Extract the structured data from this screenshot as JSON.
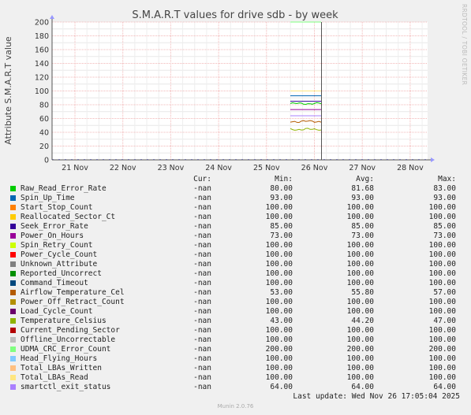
{
  "chart_data": {
    "type": "line",
    "title": "S.M.A.R.T values for drive sdb - by week",
    "ylabel": "Attribute S.M.A.R.T value",
    "ylim": [
      0,
      200
    ],
    "yticks": [
      "0",
      "20",
      "40",
      "60",
      "80",
      "100",
      "120",
      "140",
      "160",
      "180",
      "200"
    ],
    "categories": [
      "21 Nov",
      "22 Nov",
      "23 Nov",
      "24 Nov",
      "25 Nov",
      "26 Nov",
      "27 Nov",
      "28 Nov"
    ],
    "grid": true,
    "legend_position": "bottom",
    "side_label": "RRDTOOL / TOBI OETIKER",
    "data_window": [
      "26 Nov",
      "26 Nov 17:05"
    ],
    "columns": [
      "Cur:",
      "Min:",
      "Avg:",
      "Max:"
    ],
    "series": [
      {
        "name": "Raw_Read_Error_Rate",
        "color": "#00cc00",
        "cur": "-nan",
        "min": "80.00",
        "avg": "81.68",
        "max": "83.00",
        "min_v": 80,
        "avg_v": 81.68,
        "max_v": 83
      },
      {
        "name": "Spin_Up_Time",
        "color": "#0066b3",
        "cur": "-nan",
        "min": "93.00",
        "avg": "93.00",
        "max": "93.00",
        "min_v": 93,
        "avg_v": 93,
        "max_v": 93
      },
      {
        "name": "Start_Stop_Count",
        "color": "#ff8000",
        "cur": "-nan",
        "min": "100.00",
        "avg": "100.00",
        "max": "100.00",
        "min_v": 100,
        "avg_v": 100,
        "max_v": 100
      },
      {
        "name": "Reallocated_Sector_Ct",
        "color": "#ffcc00",
        "cur": "-nan",
        "min": "100.00",
        "avg": "100.00",
        "max": "100.00",
        "min_v": 100,
        "avg_v": 100,
        "max_v": 100
      },
      {
        "name": "Seek_Error_Rate",
        "color": "#330099",
        "cur": "-nan",
        "min": "85.00",
        "avg": "85.00",
        "max": "85.00",
        "min_v": 85,
        "avg_v": 85,
        "max_v": 85
      },
      {
        "name": "Power_On_Hours",
        "color": "#990099",
        "cur": "-nan",
        "min": "73.00",
        "avg": "73.00",
        "max": "73.00",
        "min_v": 73,
        "avg_v": 73,
        "max_v": 73
      },
      {
        "name": "Spin_Retry_Count",
        "color": "#ccff00",
        "cur": "-nan",
        "min": "100.00",
        "avg": "100.00",
        "max": "100.00",
        "min_v": 100,
        "avg_v": 100,
        "max_v": 100
      },
      {
        "name": "Power_Cycle_Count",
        "color": "#ff0000",
        "cur": "-nan",
        "min": "100.00",
        "avg": "100.00",
        "max": "100.00",
        "min_v": 100,
        "avg_v": 100,
        "max_v": 100
      },
      {
        "name": "Unknown_Attribute",
        "color": "#808080",
        "cur": "-nan",
        "min": "100.00",
        "avg": "100.00",
        "max": "100.00",
        "min_v": 100,
        "avg_v": 100,
        "max_v": 100
      },
      {
        "name": "Reported_Uncorrect",
        "color": "#008f00",
        "cur": "-nan",
        "min": "100.00",
        "avg": "100.00",
        "max": "100.00",
        "min_v": 100,
        "avg_v": 100,
        "max_v": 100
      },
      {
        "name": "Command_Timeout",
        "color": "#00487d",
        "cur": "-nan",
        "min": "100.00",
        "avg": "100.00",
        "max": "100.00",
        "min_v": 100,
        "avg_v": 100,
        "max_v": 100
      },
      {
        "name": "Airflow_Temperature_Cel",
        "color": "#b35a00",
        "cur": "-nan",
        "min": "53.00",
        "avg": "55.80",
        "max": "57.00",
        "min_v": 53,
        "avg_v": 55.8,
        "max_v": 57
      },
      {
        "name": "Power_Off_Retract_Count",
        "color": "#b38f00",
        "cur": "-nan",
        "min": "100.00",
        "avg": "100.00",
        "max": "100.00",
        "min_v": 100,
        "avg_v": 100,
        "max_v": 100
      },
      {
        "name": "Load_Cycle_Count",
        "color": "#6b006b",
        "cur": "-nan",
        "min": "100.00",
        "avg": "100.00",
        "max": "100.00",
        "min_v": 100,
        "avg_v": 100,
        "max_v": 100
      },
      {
        "name": "Temperature_Celsius",
        "color": "#8fb300",
        "cur": "-nan",
        "min": "43.00",
        "avg": "44.20",
        "max": "47.00",
        "min_v": 43,
        "avg_v": 44.2,
        "max_v": 47
      },
      {
        "name": "Current_Pending_Sector",
        "color": "#b30000",
        "cur": "-nan",
        "min": "100.00",
        "avg": "100.00",
        "max": "100.00",
        "min_v": 100,
        "avg_v": 100,
        "max_v": 100
      },
      {
        "name": "Offline_Uncorrectable",
        "color": "#bebebe",
        "cur": "-nan",
        "min": "100.00",
        "avg": "100.00",
        "max": "100.00",
        "min_v": 100,
        "avg_v": 100,
        "max_v": 100
      },
      {
        "name": "UDMA_CRC_Error_Count",
        "color": "#80ff80",
        "cur": "-nan",
        "min": "200.00",
        "avg": "200.00",
        "max": "200.00",
        "min_v": 200,
        "avg_v": 200,
        "max_v": 200
      },
      {
        "name": "Head_Flying_Hours",
        "color": "#80c9ff",
        "cur": "-nan",
        "min": "100.00",
        "avg": "100.00",
        "max": "100.00",
        "min_v": 100,
        "avg_v": 100,
        "max_v": 100
      },
      {
        "name": "Total_LBAs_Written",
        "color": "#ffc080",
        "cur": "-nan",
        "min": "100.00",
        "avg": "100.00",
        "max": "100.00",
        "min_v": 100,
        "avg_v": 100,
        "max_v": 100
      },
      {
        "name": "Total_LBAs_Read",
        "color": "#ffe680",
        "cur": "-nan",
        "min": "100.00",
        "avg": "100.00",
        "max": "100.00",
        "min_v": 100,
        "avg_v": 100,
        "max_v": 100
      },
      {
        "name": "smartctl_exit_status",
        "color": "#aa80ff",
        "cur": "-nan",
        "min": "64.00",
        "avg": "64.00",
        "max": "64.00",
        "min_v": 64,
        "avg_v": 64,
        "max_v": 64
      }
    ]
  },
  "footer": {
    "last_update": "Last update: Wed Nov 26 17:05:04 2025",
    "munin_version": "Munin 2.0.76"
  }
}
